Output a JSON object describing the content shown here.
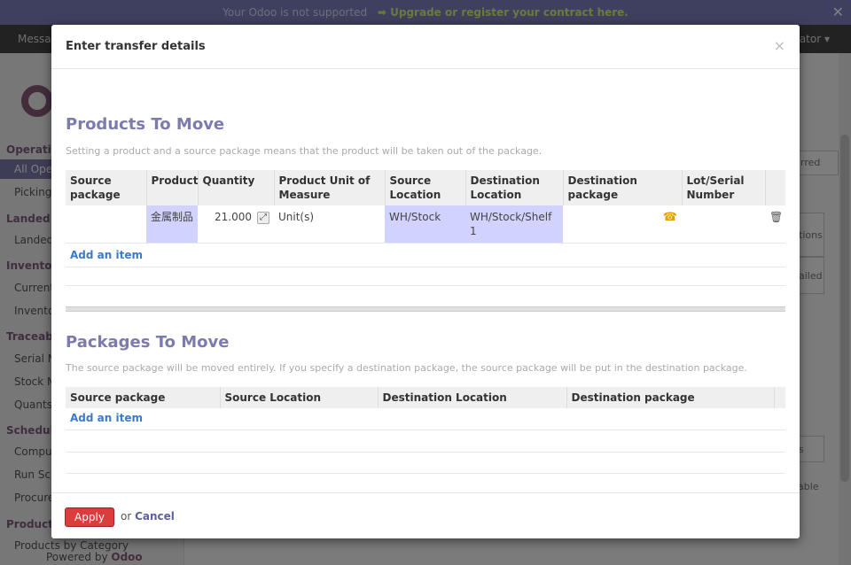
{
  "banner": {
    "text": "Your Odoo is not supported",
    "link": "➡ Upgrade or register your contract here.",
    "close": "✕"
  },
  "nav": {
    "left": "Messa",
    "right": "ator ▾"
  },
  "sidebar": {
    "sections": [
      {
        "title": "Operatio",
        "items": [
          "All Ope",
          "Picking"
        ]
      },
      {
        "title": "Landed C",
        "items": [
          "Landed"
        ]
      },
      {
        "title": "Inventory",
        "items": [
          "Current",
          "Invento"
        ]
      },
      {
        "title": "Traceabi",
        "items": [
          "Serial N",
          "Stock M",
          "Quants"
        ]
      },
      {
        "title": "Schedule",
        "items": [
          "Compu",
          "Run Sc",
          "Procure"
        ]
      },
      {
        "title": "Products",
        "items": [
          "Products by Category"
        ]
      }
    ],
    "powered_by": "Powered by",
    "brand": "Odoo"
  },
  "bg_right": {
    "tab": "rred",
    "box1": "tions",
    "box2": "ailed",
    "box3": "s",
    "box4": "able"
  },
  "modal": {
    "title": "Enter transfer details",
    "close": "×",
    "products": {
      "title": "Products To Move",
      "help": "Setting a product and a source package means that the product will be taken out of the package.",
      "columns": [
        "Source package",
        "Product",
        "Quantity",
        "Product Unit of Measure",
        "Source Location",
        "Destination Location",
        "Destination package",
        "Lot/Serial Number"
      ],
      "rows": [
        {
          "source_package": "",
          "product": "金属制品",
          "quantity": "21.000",
          "uom": "Unit(s)",
          "source_location": "WH/Stock",
          "destination_location": "WH/Stock/Shelf 1",
          "destination_package": "",
          "lot": ""
        }
      ],
      "add_item": "Add an item"
    },
    "packages": {
      "title": "Packages To Move",
      "help": "The source package will be moved entirely. If you specify a destination package, the source package will be put in the destination package.",
      "columns": [
        "Source package",
        "Source Location",
        "Destination Location",
        "Destination package"
      ],
      "add_item": "Add an item"
    },
    "footer": {
      "apply": "Apply",
      "or": "or",
      "cancel": "Cancel"
    }
  }
}
